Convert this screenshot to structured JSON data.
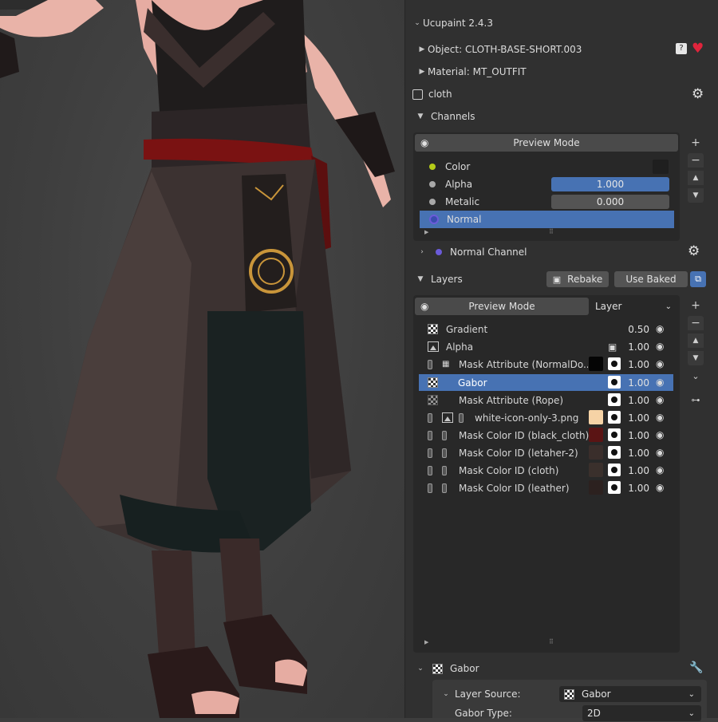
{
  "viewport": {
    "description_label": ""
  },
  "panel": {
    "addon_title": "Ucupaint 2.4.3",
    "object_label": "Object: CLOTH-BASE-SHORT.003",
    "material_label": "Material: MT_OUTFIT",
    "image_name": "cloth",
    "channels_header": "Channels",
    "channels_preview_mode": "Preview Mode",
    "channels": [
      {
        "name": "Color",
        "dot_color": "#b5cc18",
        "value": ""
      },
      {
        "name": "Alpha",
        "dot_color": "#a8a8a8",
        "value": "1.000"
      },
      {
        "name": "Metalic",
        "dot_color": "#a8a8a8",
        "value": "0.000"
      },
      {
        "name": "Normal",
        "dot_color": "#6b5bd9",
        "value": ""
      }
    ],
    "normal_channel_label": "Normal Channel",
    "layers_header": "Layers",
    "rebake_label": "Rebake",
    "use_baked_label": "Use Baked",
    "layers_preview_mode": "Preview Mode",
    "layer_dropdown": "Layer",
    "layers": [
      {
        "name": "Gradient",
        "value": "0.50",
        "swatch": ""
      },
      {
        "name": "Alpha",
        "value": "1.00",
        "swatch": ""
      },
      {
        "name": "Mask Attribute (NormalDo...",
        "value": "1.00",
        "swatch": "#050505"
      },
      {
        "name": "Gabor",
        "value": "1.00",
        "swatch": ""
      },
      {
        "name": "Mask Attribute (Rope)",
        "value": "1.00",
        "swatch": ""
      },
      {
        "name": "white-icon-only-3.png",
        "value": "1.00",
        "swatch": "#f6d3a6"
      },
      {
        "name": "Mask Color ID (black_cloth)",
        "value": "1.00",
        "swatch": "#5a1414"
      },
      {
        "name": "Mask Color ID (letaher-2)",
        "value": "1.00",
        "swatch": "#3a2e2b"
      },
      {
        "name": "Mask Color ID (cloth)",
        "value": "1.00",
        "swatch": "#3a302c"
      },
      {
        "name": "Mask Color ID (leather)",
        "value": "1.00",
        "swatch": "#2c211f"
      }
    ],
    "gabor_header": "Gabor",
    "layer_source_label": "Layer Source:",
    "layer_source_value": "Gabor",
    "gabor_type_label": "Gabor Type:",
    "gabor_type_value": "2D"
  },
  "colors": {
    "accent": "#4772b3",
    "panel_bg": "#303030",
    "field_bg": "#545454"
  }
}
